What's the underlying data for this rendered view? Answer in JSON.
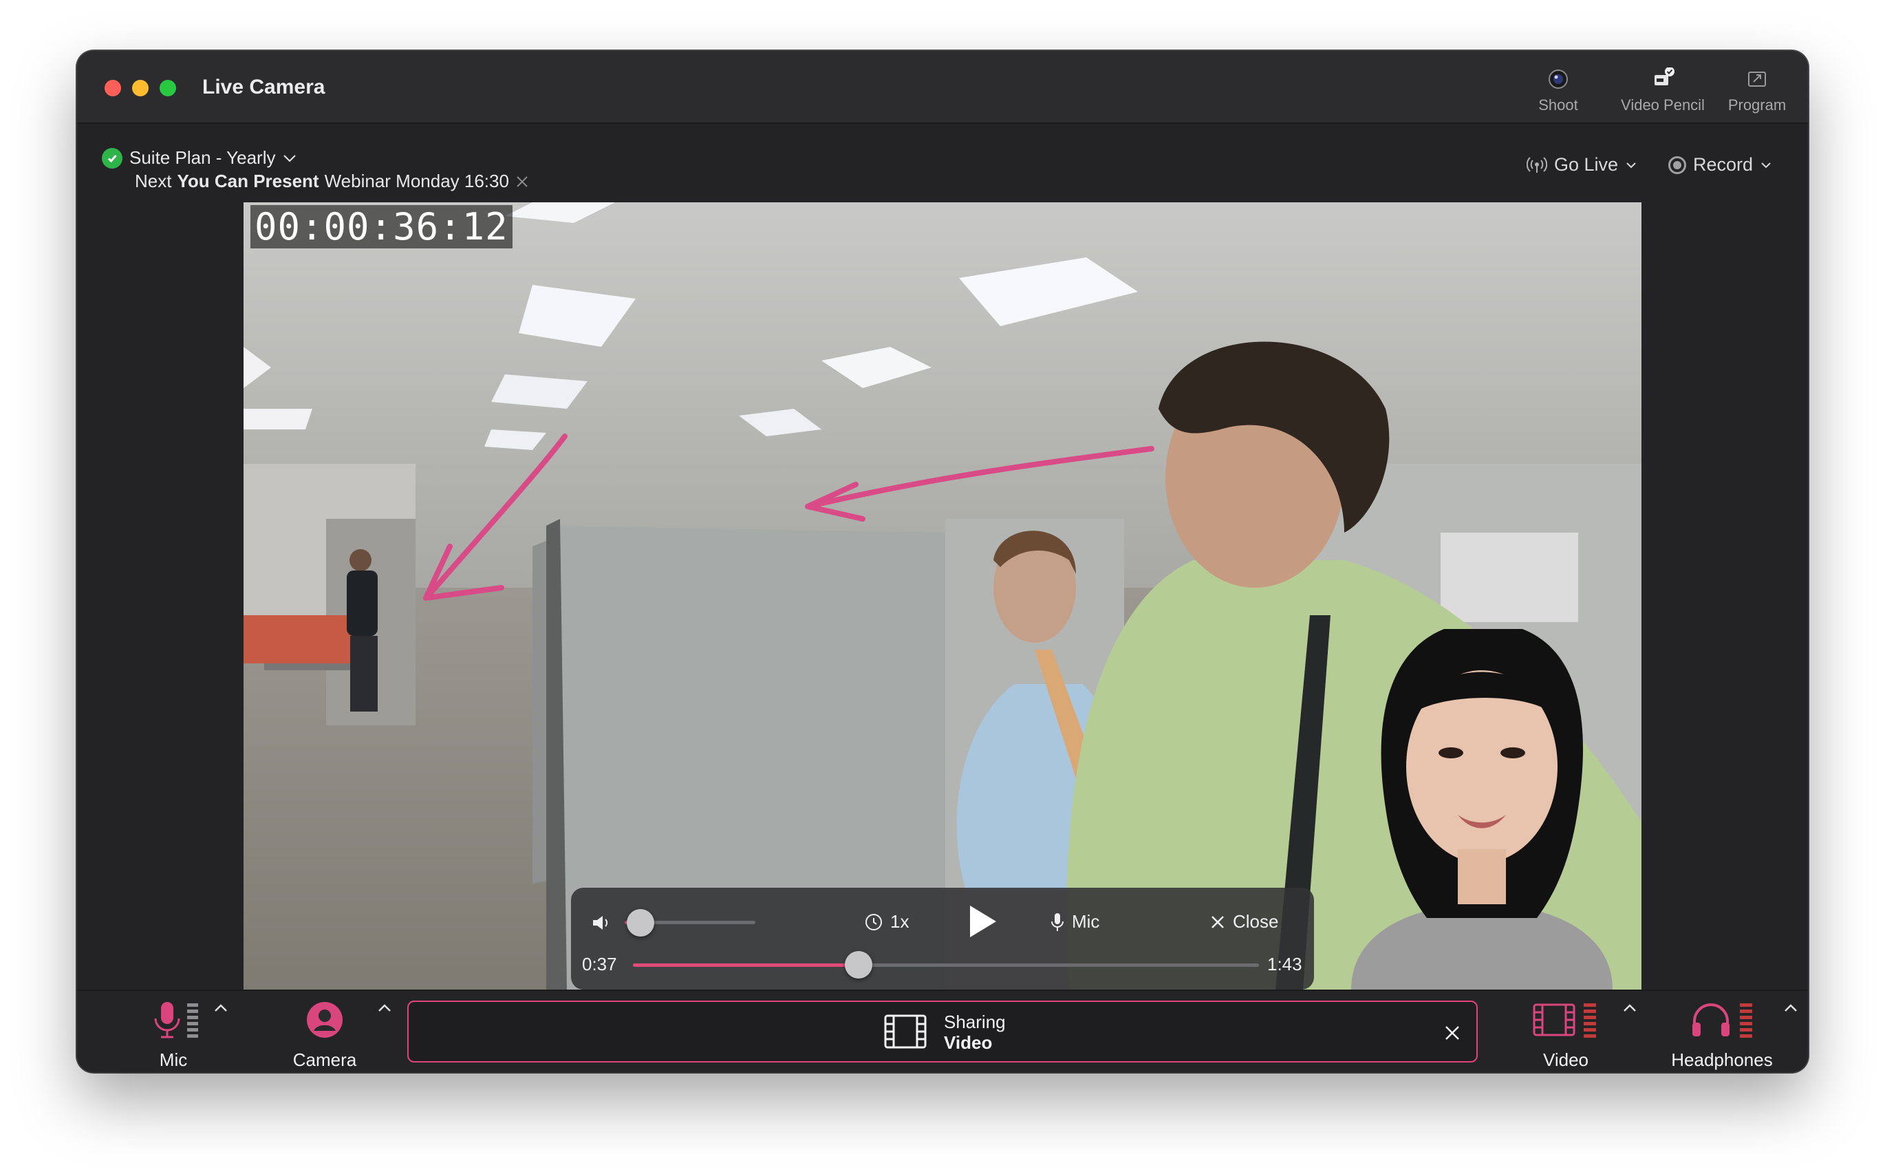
{
  "window": {
    "title": "Live Camera"
  },
  "toolbar": {
    "items": [
      {
        "label": "Shoot",
        "icon": "camera-lens-icon"
      },
      {
        "label": "Video Pencil",
        "icon": "video-pencil-icon"
      },
      {
        "label": "Program",
        "icon": "expand-icon"
      }
    ]
  },
  "plan": {
    "label": "Suite Plan - Yearly"
  },
  "next_event": {
    "prefix": "Next",
    "bold": "You Can Present",
    "suffix": "Webinar Monday 16:30"
  },
  "actions": {
    "go_live": "Go Live",
    "record": "Record"
  },
  "video": {
    "timecode": "00:00:36:12"
  },
  "player": {
    "speed": "1x",
    "mic": "Mic",
    "close": "Close",
    "current_time": "0:37",
    "duration": "1:43",
    "volume_level": 0.12,
    "progress": 0.36
  },
  "dock": {
    "mic": "Mic",
    "camera": "Camera",
    "sharing_label": "Sharing",
    "sharing_value": "Video",
    "video": "Video",
    "headphones": "Headphones"
  },
  "colors": {
    "accent": "#e0457a",
    "success": "#2fb34b",
    "window_bg": "#232325"
  }
}
